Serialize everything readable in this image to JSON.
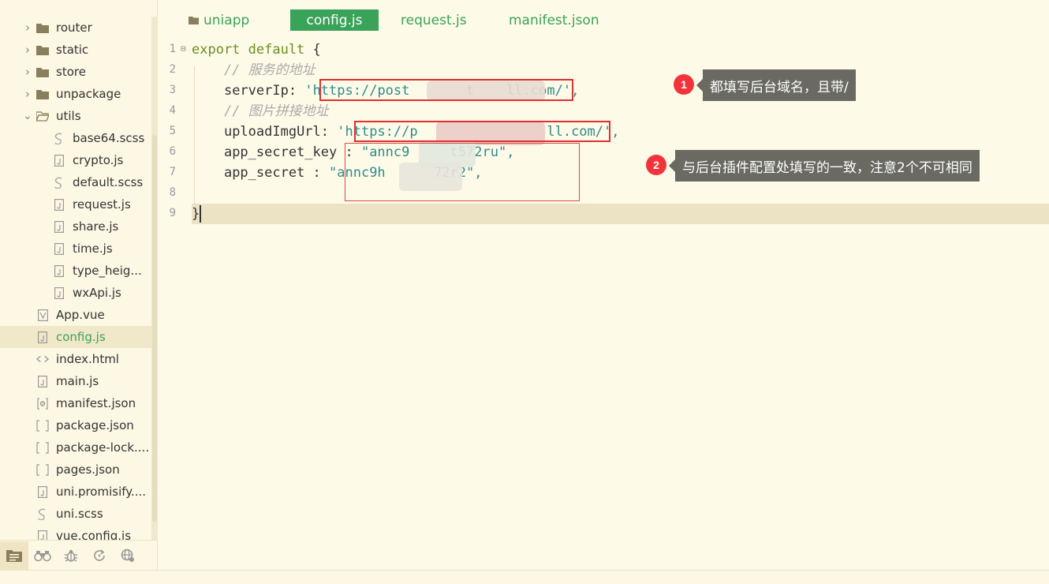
{
  "sidebar": {
    "items": [
      {
        "label": "router",
        "kind": "folder",
        "level": 1,
        "chevron": "right"
      },
      {
        "label": "static",
        "kind": "folder",
        "level": 1,
        "chevron": "right"
      },
      {
        "label": "store",
        "kind": "folder",
        "level": 1,
        "chevron": "right"
      },
      {
        "label": "unpackage",
        "kind": "folder",
        "level": 1,
        "chevron": "right"
      },
      {
        "label": "utils",
        "kind": "folder-open",
        "level": 1,
        "chevron": "down"
      },
      {
        "label": "base64.scss",
        "kind": "scss",
        "level": 2
      },
      {
        "label": "crypto.js",
        "kind": "js",
        "level": 2
      },
      {
        "label": "default.scss",
        "kind": "scss",
        "level": 2
      },
      {
        "label": "request.js",
        "kind": "js",
        "level": 2
      },
      {
        "label": "share.js",
        "kind": "js",
        "level": 2
      },
      {
        "label": "time.js",
        "kind": "js",
        "level": 2
      },
      {
        "label": "type_heig...",
        "kind": "js",
        "level": 2
      },
      {
        "label": "wxApi.js",
        "kind": "js",
        "level": 2
      },
      {
        "label": "App.vue",
        "kind": "vue",
        "level": 1
      },
      {
        "label": "config.js",
        "kind": "js",
        "level": 1,
        "active": true
      },
      {
        "label": "index.html",
        "kind": "html",
        "level": 1
      },
      {
        "label": "main.js",
        "kind": "js",
        "level": 1
      },
      {
        "label": "manifest.json",
        "kind": "manifest",
        "level": 1
      },
      {
        "label": "package.json",
        "kind": "json",
        "level": 1
      },
      {
        "label": "package-lock....",
        "kind": "json",
        "level": 1
      },
      {
        "label": "pages.json",
        "kind": "json",
        "level": 1
      },
      {
        "label": "uni.promisify....",
        "kind": "js",
        "level": 1
      },
      {
        "label": "uni.scss",
        "kind": "scss",
        "level": 1
      },
      {
        "label": "vue.config.js",
        "kind": "js",
        "level": 1
      }
    ],
    "toolbar": [
      "files-icon",
      "binoculars-icon",
      "bug-icon",
      "refresh-icon",
      "globe-icon"
    ]
  },
  "tabs": [
    {
      "label": "uniapp",
      "icon": "folder-icon"
    },
    {
      "label": "config.js",
      "active": true
    },
    {
      "label": "request.js"
    },
    {
      "label": "manifest.json"
    }
  ],
  "editor": {
    "line_numbers": [
      "1",
      "2",
      "3",
      "4",
      "5",
      "6",
      "7",
      "8",
      "9"
    ],
    "current_line": 9,
    "lines": {
      "l1_kw": "export default",
      "l1_brace": "{",
      "l2_comment": "// 服务的地址",
      "l3_key": "serverIp: ",
      "l3_q1": "'",
      "l3_url": "https://post       t    ll.com/",
      "l3_q2": "',",
      "l4_comment": "// 图片拼接地址",
      "l5_key": "uploadImgUrl: ",
      "l5_q1": "'",
      "l5_url": "https://p                ll.com/",
      "l5_q2": "',",
      "l6_key": "app_secret_key : ",
      "l6_val": "\"annc9     t572ru\",",
      "l7_key": "app_secret : ",
      "l7_val": "\"annc9h      72r2\",",
      "l9_brace": "}"
    }
  },
  "annotations": [
    {
      "number": "1",
      "text": "都填写后台域名，且带/"
    },
    {
      "number": "2",
      "text": "与后台插件配置处填写的一致，注意2个不可相同"
    }
  ],
  "colors": {
    "accent": "#3aa35a",
    "highlight": "#e03030",
    "badge": "#f2343a",
    "callout_bg": "#6a6a62",
    "background": "#fefae8"
  }
}
